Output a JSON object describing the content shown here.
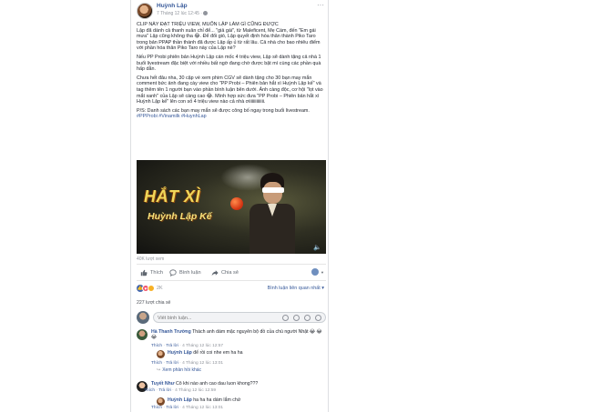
{
  "post": {
    "page_name": "Huỳnh Lập",
    "time": "7 Tháng 12 lúc 12:45 · ",
    "more": "···",
    "paragraphs": [
      "CLIP NÀY ĐẠT TRIỆU VIEW, MUỐN LẬP LÀM GÌ CŨNG ĐƯỢC",
      "Lập đã dành cả thanh xuân chỉ để... \"giả gái\", từ Maleficent, Mẹ Cám, đến \"Em gái mưa\" Lập cũng không tha 😂. Để đổi gió, Lập quyết định hóa thân thành Piko Taro trong bản PPAP thần thánh đã được Lập ấp ủ từ rất lâu. Cả nhà cho bao nhiêu điểm với phần hóa thân Piko Taro này của Lập nè?",
      "Nếu PP Probi phiên bản Huỳnh Lập cán mốc 4 triệu view, Lập sẽ dành tặng cả nhà 1 buổi livestream đặc biệt với nhiều bất ngờ đang chờ được bật mí cùng các phần quà hấp dẫn.",
      "Chưa hết đâu nha, 30 cặp vé xem phim CGV sẽ dành tặng cho 30 bạn may mắn comment bức ảnh đang cày view cho \"PP Probi – Phiên bản hắt xì Huỳnh Lập kế\" và tag thêm tên 1 người bạn vào phần bình luận bên dưới. Ảnh càng độc, cơ hội \"lọt vào mắt xanh\" của Lập sẽ càng cao 😂. Mình hợp sức đưa \"PP Probi – Phiên bản hắt xì Huỳnh Lập kế\" lên con số 4 triệu view nào cả nhà ơiiiiiiiiiiiiii.",
      "P/S: Danh sách các bạn may mắn sẽ được công bố ngay trong buổi livestream."
    ],
    "hashtags": "#PPProbi #Vinamilk #HuynhLap",
    "video_title_1": "HẮT XÌ",
    "video_title_2": "Huỳnh Lập Kế",
    "views": "40K lượt xem",
    "like_label": "Thích",
    "comment_label": "Bình luận",
    "share_label": "Chia sẻ",
    "reaction_count": "2K",
    "sort_label": "Bình luận liên quan nhất ▾",
    "shares": "227 lượt chia sẻ",
    "comment_placeholder": "Viết bình luận..."
  },
  "comments": [
    {
      "name": "Hà Thanh Trường",
      "text": " Thách anh dám mặc nguyên bộ đồ của chú người Nhật 😂 😂 😂",
      "like": "Thích",
      "reply": "Trả lời",
      "time": " · 4 Tháng 12 lúc 12:57"
    },
    {
      "name": "Huỳnh Lập",
      "text": " để rồi coi nhe em ha ha",
      "like": "Thích",
      "reply": "Trả lời",
      "time": " · 4 Tháng 12 lúc 13:01"
    },
    {
      "name": "Tuyết Như",
      "text": " Cô khi nào anh cao dau luon khong???",
      "like": "Thích",
      "reply": "Trả lời",
      "time": " · 4 Tháng 12 lúc 12:59"
    },
    {
      "name": "Huỳnh Lập",
      "text": " ha ha ha dám lắm chứ",
      "like": "Thích",
      "reply": "Trả lời",
      "time": " · 4 Tháng 12 lúc 13:01"
    }
  ],
  "more_replies": "Xem phản hồi khác",
  "colors": {
    "link": "#365899",
    "muted": "#90949c",
    "like_blue": "#4267b2",
    "love_red": "#f25268",
    "haha_yellow": "#f7b125"
  }
}
